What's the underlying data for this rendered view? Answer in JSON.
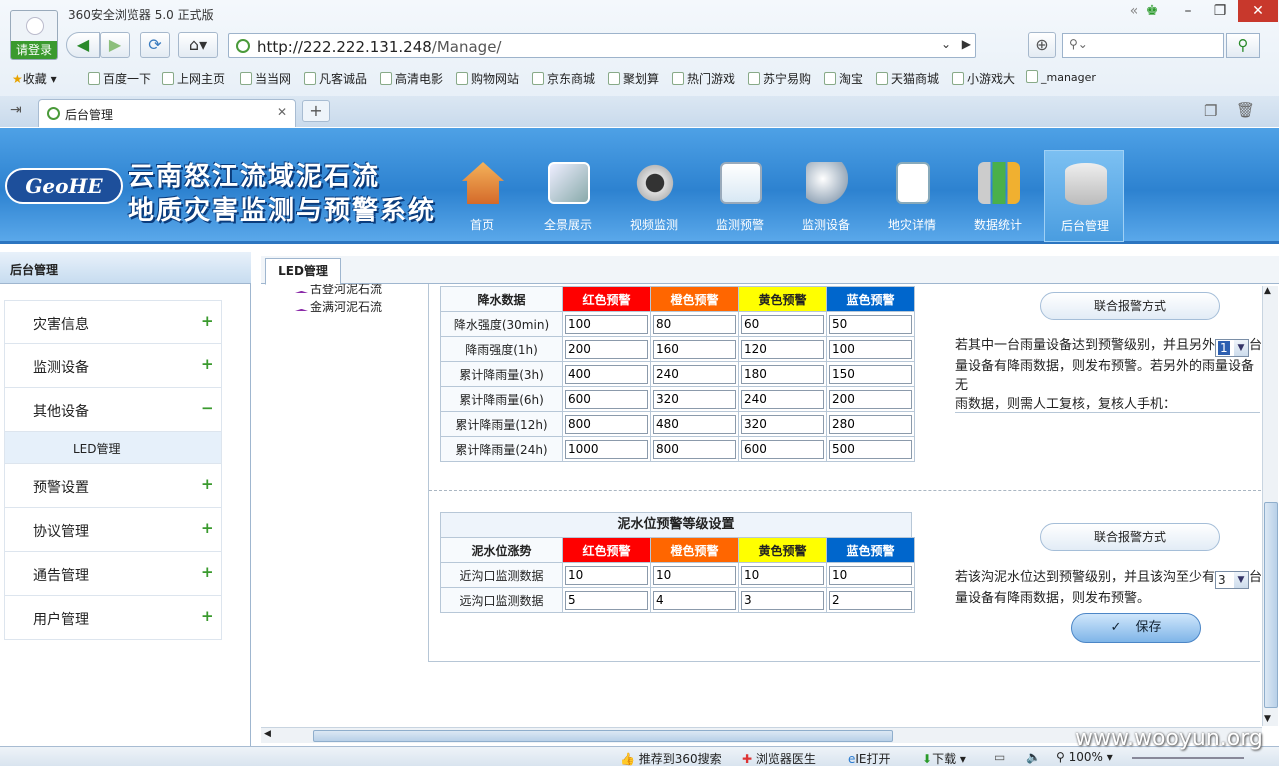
{
  "browser": {
    "title": "360安全浏览器 5.0 正式版",
    "login_label": "请登录",
    "url_host": "http://222.222.131.248",
    "url_path": "/Manage/",
    "search_placeholder": "",
    "bookmarks": [
      "收藏",
      "百度一下",
      "上网主页",
      "当当网",
      "凡客诚品",
      "高清电影",
      "购物网站",
      "京东商城",
      "聚划算",
      "热门游戏",
      "苏宁易购",
      "淘宝",
      "天猫商城",
      "小游戏大",
      "_manager"
    ],
    "tab_title": "后台管理",
    "status": {
      "recommend": "推荐到360搜索",
      "doctor": "浏览器医生",
      "ie_open": "IE打开",
      "download": "下载",
      "zoom": "100%"
    },
    "watermark": "www.wooyun.org"
  },
  "banner": {
    "logo_text": "GeoHE",
    "title_line1": "云南怒江流域泥石流",
    "title_line2": "地质灾害监测与预警系统",
    "nav": [
      {
        "label": "首页",
        "icon": "house-icon"
      },
      {
        "label": "全景展示",
        "icon": "panorama-icon"
      },
      {
        "label": "视频监测",
        "icon": "webcam-icon"
      },
      {
        "label": "监测预警",
        "icon": "warning-chart-icon"
      },
      {
        "label": "监测设备",
        "icon": "satellite-dish-icon"
      },
      {
        "label": "地灾详情",
        "icon": "document-icon"
      },
      {
        "label": "数据统计",
        "icon": "bar-chart-icon"
      },
      {
        "label": "后台管理",
        "icon": "database-gear-icon"
      }
    ]
  },
  "sidebar": {
    "header": "后台管理",
    "menu": [
      {
        "label": "灾害信息",
        "sign": "+"
      },
      {
        "label": "监测设备",
        "sign": "+"
      },
      {
        "label": "其他设备",
        "sign": "−"
      },
      {
        "label": "预警设置",
        "sign": "+"
      },
      {
        "label": "协议管理",
        "sign": "+"
      },
      {
        "label": "通告管理",
        "sign": "+"
      },
      {
        "label": "用户管理",
        "sign": "+"
      }
    ],
    "submenu": "LED管理"
  },
  "main": {
    "tab": "LED管理",
    "tree": [
      "古登河泥石流",
      "金满河泥石流"
    ],
    "rain": {
      "header": "降水数据",
      "levels": [
        "红色预警",
        "橙色预警",
        "黄色预警",
        "蓝色预警"
      ],
      "rows": [
        {
          "label": "降水强度(30min)",
          "values": [
            "100",
            "80",
            "60",
            "50"
          ]
        },
        {
          "label": "降雨强度(1h)",
          "values": [
            "200",
            "160",
            "120",
            "100"
          ]
        },
        {
          "label": "累计降雨量(3h)",
          "values": [
            "400",
            "240",
            "180",
            "150"
          ]
        },
        {
          "label": "累计降雨量(6h)",
          "values": [
            "600",
            "320",
            "240",
            "200"
          ]
        },
        {
          "label": "累计降雨量(12h)",
          "values": [
            "800",
            "480",
            "320",
            "280"
          ]
        },
        {
          "label": "累计降雨量(24h)",
          "values": [
            "1000",
            "800",
            "600",
            "500"
          ]
        }
      ],
      "joint_button": "联合报警方式",
      "desc_a": "若其中一台雨量设备达到预警级别，并且另外",
      "select_value": "1",
      "desc_b": "台",
      "desc_c": "量设备有降雨数据，则发布预警。若另外的雨量设备无",
      "desc_d": "雨数据，则需人工复核，复核人手机："
    },
    "mud": {
      "caption": "泥水位预警等级设置",
      "header": "泥水位涨势",
      "rows": [
        {
          "label": "近沟口监测数据",
          "values": [
            "10",
            "10",
            "10",
            "10"
          ]
        },
        {
          "label": "远沟口监测数据",
          "values": [
            "5",
            "4",
            "3",
            "2"
          ]
        }
      ],
      "joint_button": "联合报警方式",
      "desc_a": "若该沟泥水位达到预警级别，并且该沟至少有",
      "select_value": "3",
      "desc_b": "台",
      "desc_c": "量设备有降雨数据，则发布预警。"
    },
    "save_button": "保存"
  }
}
